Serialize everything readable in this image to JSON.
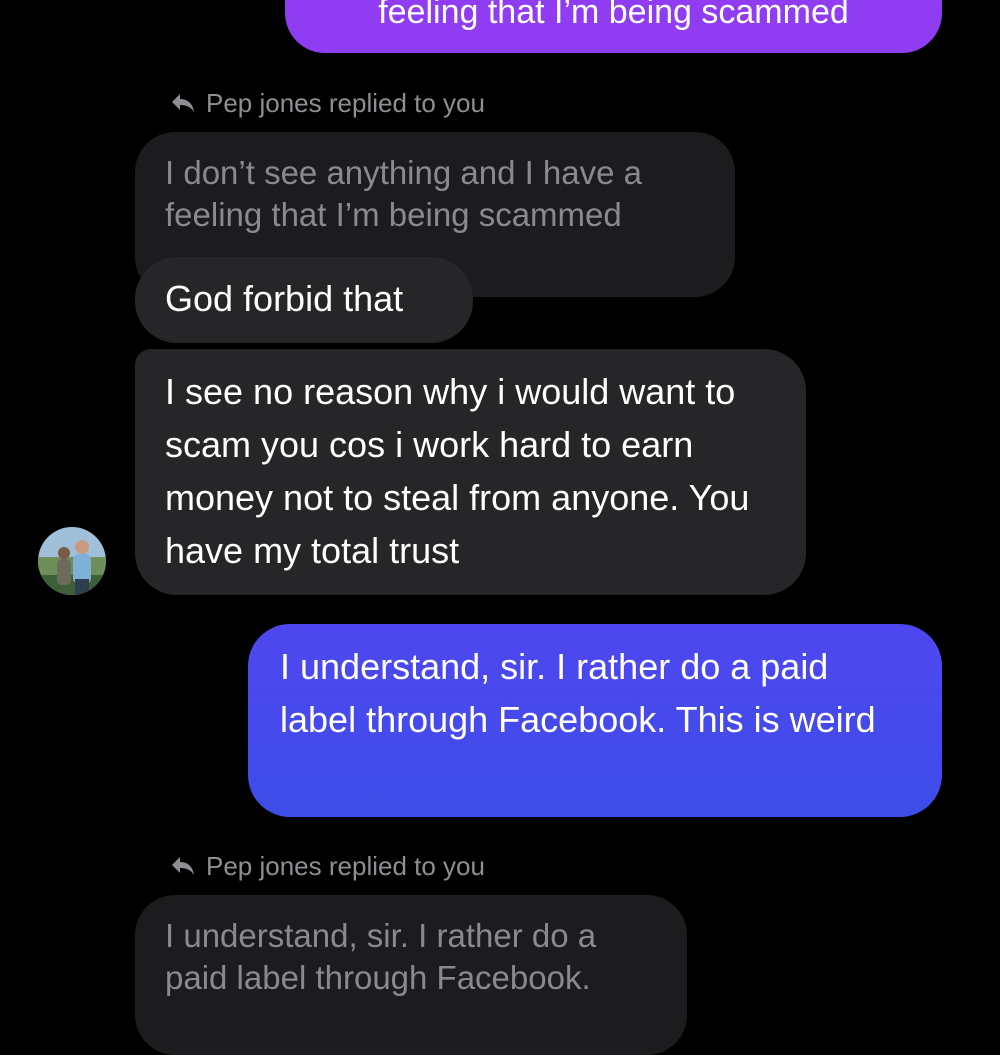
{
  "messages": {
    "top_sent": "feeling that I’m being scammed",
    "reply_label_1": "Pep jones replied to you",
    "quoted_1": "I don’t see anything and I have a feeling that I’m being scammed",
    "recv_1": "God forbid that",
    "recv_2": "I see no reason why i would want to scam you cos i work hard to earn money not to steal from anyone. You have my total trust",
    "sent_main": "I understand, sir. I rather do a paid label through Facebook. This is weird",
    "reply_label_2": "Pep jones replied to you",
    "quoted_2": "I understand, sir. I rather do a paid label through Facebook."
  },
  "icons": {
    "reply": "reply-arrow-icon",
    "avatar": "avatar"
  },
  "colors": {
    "background": "#000000",
    "sent_purple": "#8f3cf2",
    "sent_blue": "#4e47ef",
    "received_bubble": "#262628",
    "quoted_bubble": "#1c1c1e",
    "meta_text": "#8e8e93"
  }
}
